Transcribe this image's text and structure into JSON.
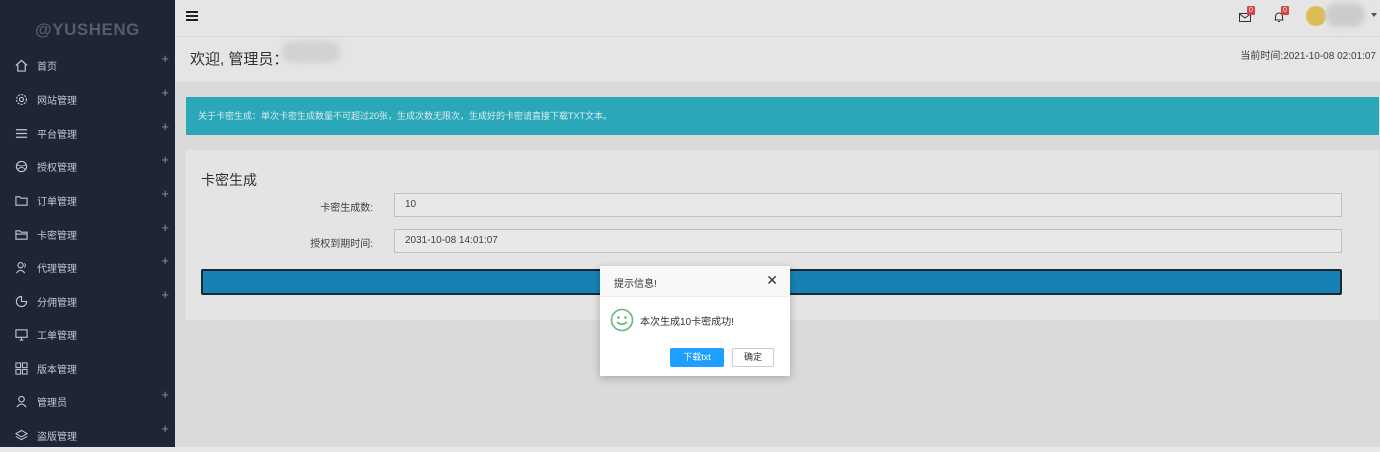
{
  "brand": "@YUSHENG",
  "sidebar": {
    "items": [
      {
        "label": "首页",
        "icon": "home-icon",
        "plus": "+"
      },
      {
        "label": "网站管理",
        "icon": "gear-icon",
        "plus": "+"
      },
      {
        "label": "平台管理",
        "icon": "list-icon",
        "plus": "+"
      },
      {
        "label": "授权管理",
        "icon": "globe-icon",
        "plus": "+"
      },
      {
        "label": "订单管理",
        "icon": "folder-icon",
        "plus": "+"
      },
      {
        "label": "卡密管理",
        "icon": "folder-open-icon",
        "plus": "+"
      },
      {
        "label": "代理管理",
        "icon": "users-icon",
        "plus": "+"
      },
      {
        "label": "分佣管理",
        "icon": "pie-icon",
        "plus": "+"
      },
      {
        "label": "工单管理",
        "icon": "monitor-icon",
        "plus": ""
      },
      {
        "label": "版本管理",
        "icon": "grid-icon",
        "plus": ""
      },
      {
        "label": "管理员",
        "icon": "user-icon",
        "plus": "+"
      },
      {
        "label": "盗版管理",
        "icon": "layers-icon",
        "plus": "+"
      }
    ]
  },
  "topbar": {
    "mail_badge": "0",
    "bell_badge": "0"
  },
  "header": {
    "welcome": "欢迎, 管理员：",
    "current_time": "当前时间:2021-10-08 02:01:07"
  },
  "alert": {
    "text": "关于卡密生成：单次卡密生成数量不可超过20张，生成次数无限次，生成好的卡密请直接下载TXT文本。"
  },
  "card": {
    "title": "卡密生成",
    "fields": [
      {
        "label": "卡密生成数:",
        "value": "10"
      },
      {
        "label": "授权到期时间:",
        "value": "2031-10-08 14:01:07"
      }
    ]
  },
  "dialog": {
    "title": "提示信息!",
    "close": "✕",
    "message": "本次生成10卡密成功!",
    "download_label": "下载txt",
    "confirm_label": "确定"
  },
  "colors": {
    "sidebar_bg": "#1e2535",
    "alert_bg": "#2db3c5",
    "primary": "#1e9fff",
    "submit_bar": "#1a8ac0"
  }
}
